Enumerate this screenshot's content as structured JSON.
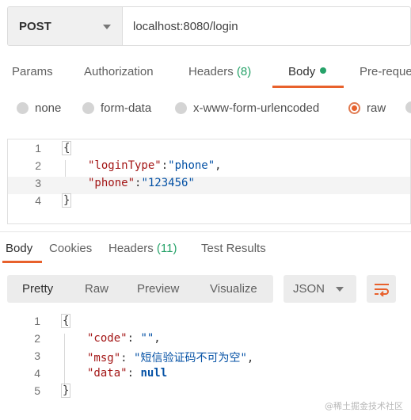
{
  "request": {
    "method": "POST",
    "url": "localhost:8080/login"
  },
  "request_tabs": {
    "params": "Params",
    "authorization": "Authorization",
    "headers": "Headers",
    "headers_count": "(8)",
    "body": "Body",
    "prerequest": "Pre-reque"
  },
  "body_modes": {
    "none": "none",
    "form_data": "form-data",
    "urlencoded": "x-www-form-urlencoded",
    "raw": "raw",
    "selected": "raw"
  },
  "request_body": {
    "line_numbers": [
      "1",
      "2",
      "3",
      "4"
    ],
    "open": "{",
    "login_type_key": "\"loginType\"",
    "login_type_value": "\"phone\"",
    "phone_key": "\"phone\"",
    "phone_value": "\"123456\"",
    "close": "}"
  },
  "response_tabs": {
    "body": "Body",
    "cookies": "Cookies",
    "headers": "Headers",
    "headers_count": "(11)",
    "test_results": "Test Results"
  },
  "response_toolbar": {
    "pretty": "Pretty",
    "raw": "Raw",
    "preview": "Preview",
    "visualize": "Visualize",
    "format": "JSON",
    "wrap_icon": "wrap-lines-icon"
  },
  "response_body": {
    "line_numbers": [
      "1",
      "2",
      "3",
      "4",
      "5"
    ],
    "open": "{",
    "code_key": "\"code\"",
    "code_value": "\"\"",
    "msg_key": "\"msg\"",
    "msg_value": "\"短信验证码不可为空\"",
    "data_key": "\"data\"",
    "data_value": "null",
    "close": "}"
  },
  "watermark": "@稀土掘金技术社区",
  "colors": {
    "accent": "#e8612c",
    "count_green": "#26a269",
    "json_key": "#a31515",
    "json_string": "#0451a5"
  }
}
